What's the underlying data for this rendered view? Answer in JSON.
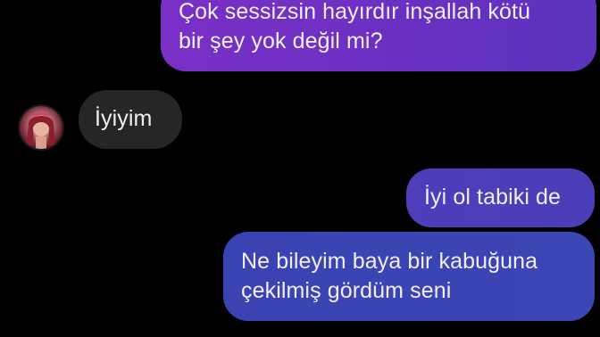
{
  "conversation": {
    "messages": [
      {
        "direction": "outgoing",
        "lines": [
          "Çok sessizsin hayırdır inşallah kötü",
          "bir şey yok değil mi?"
        ]
      },
      {
        "direction": "incoming",
        "lines": [
          "İyiyim"
        ]
      },
      {
        "direction": "outgoing",
        "lines": [
          "İyi ol tabiki de"
        ]
      },
      {
        "direction": "outgoing",
        "lines": [
          "Ne bileyim baya bir kabuğuna",
          "çekilmiş gördüm seni"
        ]
      }
    ]
  },
  "colors": {
    "background": "#000000",
    "outgoing_bubble_top": "#7a2fc6",
    "outgoing_bubble_bottom": "#3a43b1",
    "incoming_bubble": "#262626",
    "text": "#f2eefc"
  },
  "icons": {
    "avatar": "contact-avatar-photo"
  }
}
